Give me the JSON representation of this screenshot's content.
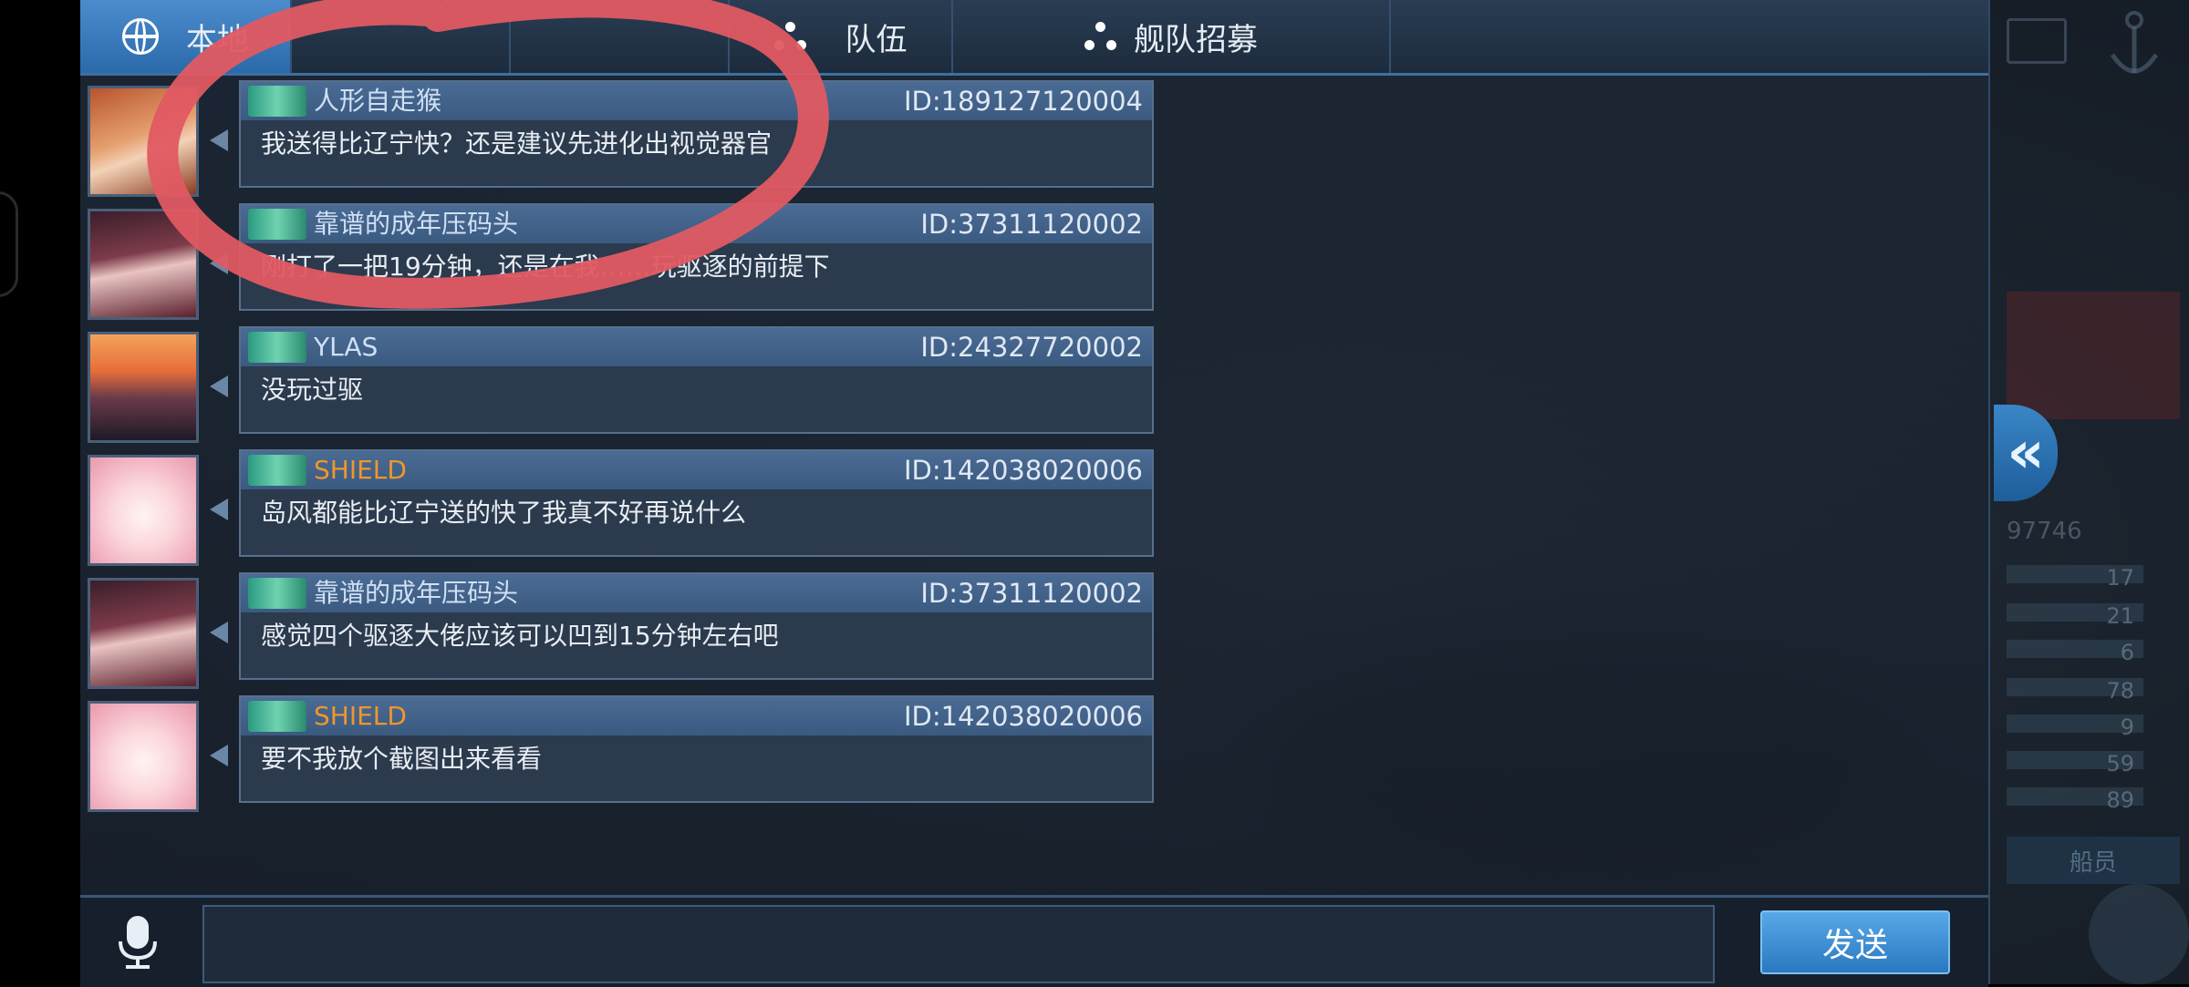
{
  "tabs": [
    {
      "label": "本地",
      "icon": "globe-icon",
      "active": true
    },
    {
      "label": "",
      "icon": "",
      "active": false
    },
    {
      "label": "",
      "icon": "",
      "active": false
    },
    {
      "label": "队伍",
      "icon": "team-dots-icon",
      "active": false
    },
    {
      "label": "舰队招募",
      "icon": "fleet-dots-icon",
      "active": false
    }
  ],
  "messages": [
    {
      "name": "人形自走猴",
      "name_color": "#cfe0f5",
      "id": "ID:189127120004",
      "text": "我送得比辽宁快？还是建议先进化出视觉器官",
      "avatar": "avatar-brown-hair"
    },
    {
      "name": "靠谱的成年压码头",
      "name_color": "#cfe0f5",
      "id": "ID:37311120002",
      "text": "刚打了一把19分钟，还是在我……玩驱逐的前提下",
      "avatar": "avatar-kimono"
    },
    {
      "name": "YLAS",
      "name_color": "#cfe0f5",
      "id": "ID:24327720002",
      "text": "没玩过驱",
      "avatar": "avatar-sunset"
    },
    {
      "name": "SHIELD",
      "name_color": "#f0962c",
      "id": "ID:142038020006",
      "text": "岛风都能比辽宁送的快了我真不好再说什么",
      "avatar": "avatar-pink-hair"
    },
    {
      "name": "靠谱的成年压码头",
      "name_color": "#cfe0f5",
      "id": "ID:37311120002",
      "text": "感觉四个驱逐大佬应该可以凹到15分钟左右吧",
      "avatar": "avatar-kimono"
    },
    {
      "name": "SHIELD",
      "name_color": "#f0962c",
      "id": "ID:142038020006",
      "text": "要不我放个截图出来看看",
      "avatar": "avatar-pink-hair"
    }
  ],
  "input": {
    "value": "",
    "placeholder": ""
  },
  "send_label": "发送",
  "side": {
    "collapse_icon": "double-chevron-left-icon",
    "crew_label": "船员",
    "number": "97746",
    "stats": [
      "17",
      "21",
      "6",
      "78",
      "9",
      "59",
      "89"
    ]
  },
  "annotation": {
    "color": "#e05a62"
  }
}
